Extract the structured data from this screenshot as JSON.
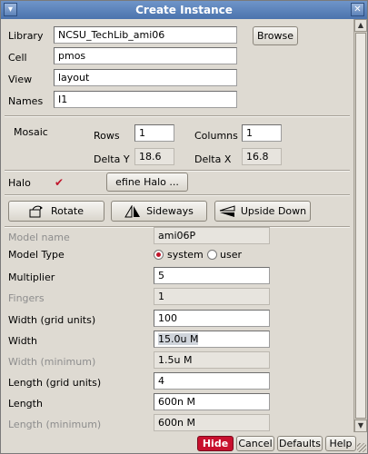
{
  "window": {
    "title": "Create Instance",
    "menu_icon": "window-menu-icon",
    "close_icon": "close-icon"
  },
  "library": {
    "label": "Library",
    "value": "NCSU_TechLib_ami06",
    "browse_label": "Browse"
  },
  "cell": {
    "label": "Cell",
    "value": "pmos"
  },
  "view": {
    "label": "View",
    "value": "layout"
  },
  "names": {
    "label": "Names",
    "value": "I1"
  },
  "mosaic": {
    "label": "Mosaic",
    "rows_label": "Rows",
    "rows_value": "1",
    "columns_label": "Columns",
    "columns_value": "1",
    "delta_y_label": "Delta Y",
    "delta_y_value": "18.6",
    "delta_x_label": "Delta X",
    "delta_x_value": "16.8"
  },
  "halo": {
    "label": "Halo",
    "checked": true,
    "define_label": "efine Halo ..."
  },
  "transforms": {
    "rotate_label": "Rotate",
    "sideways_label": "Sideways",
    "upside_down_label": "Upside Down"
  },
  "params": {
    "model_name_label": "Model name",
    "model_name_value": "ami06P",
    "model_type_label": "Model Type",
    "model_type_option1": "system",
    "model_type_option2": "user",
    "model_type_selected": "system",
    "multiplier_label": "Multiplier",
    "multiplier_value": "5",
    "fingers_label": "Fingers",
    "fingers_value": "1",
    "width_grid_label": "Width (grid units)",
    "width_grid_value": "100",
    "width_label": "Width",
    "width_value": "15.0u M",
    "width_min_label": "Width (minimum)",
    "width_min_value": "1.5u M",
    "length_grid_label": "Length (grid units)",
    "length_grid_value": "4",
    "length_label": "Length",
    "length_value": "600n M",
    "length_min_label": "Length (minimum)",
    "length_min_value": "600n M"
  },
  "footer": {
    "hide_label": "Hide",
    "cancel_label": "Cancel",
    "defaults_label": "Defaults",
    "help_label": "Help"
  }
}
